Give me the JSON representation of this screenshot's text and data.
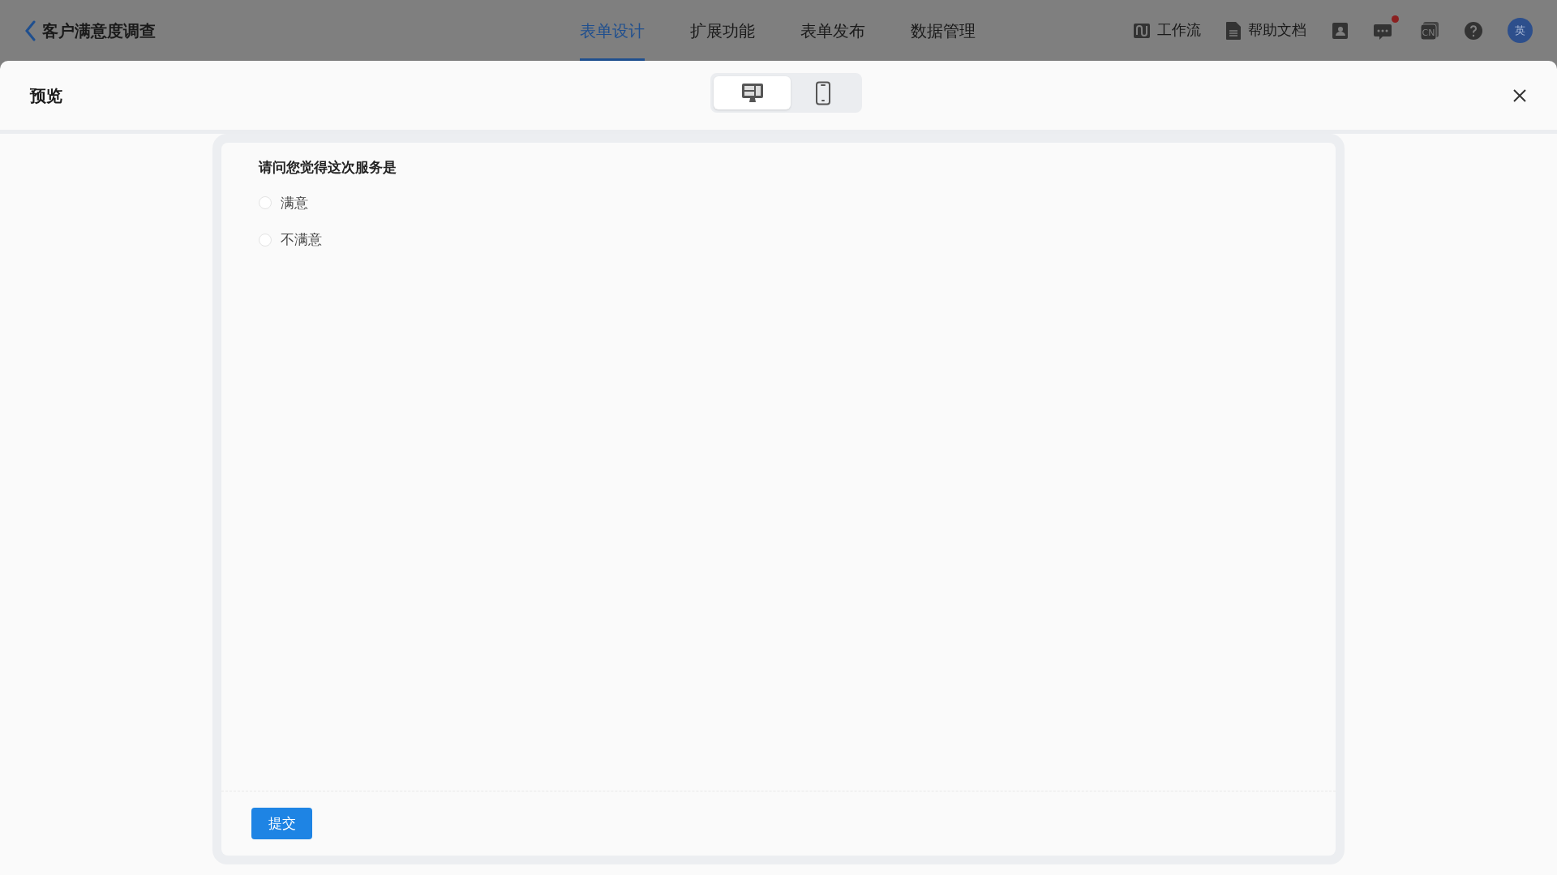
{
  "app_bar": {
    "back_title": "客户满意度调查",
    "tabs": [
      {
        "label": "表单设计",
        "selected": true
      },
      {
        "label": "扩展功能",
        "selected": false
      },
      {
        "label": "表单发布",
        "selected": false
      },
      {
        "label": "数据管理",
        "selected": false
      }
    ],
    "tools": [
      {
        "kind": "workflow",
        "label": "工作流"
      },
      {
        "kind": "docs",
        "label": "帮助文档"
      },
      {
        "kind": "contacts"
      },
      {
        "kind": "messages",
        "unread": true
      },
      {
        "kind": "language",
        "glyph": "CN"
      },
      {
        "kind": "help"
      }
    ],
    "avatar": "英"
  },
  "preview": {
    "title": "预览",
    "devices": [
      {
        "kind": "desktop",
        "selected": true
      },
      {
        "kind": "mobile",
        "selected": false
      }
    ],
    "form": {
      "question": "请问您觉得这次服务是",
      "options": [
        {
          "label": "满意",
          "selected": false
        },
        {
          "label": "不满意",
          "selected": false
        }
      ],
      "submit": "提交"
    }
  }
}
